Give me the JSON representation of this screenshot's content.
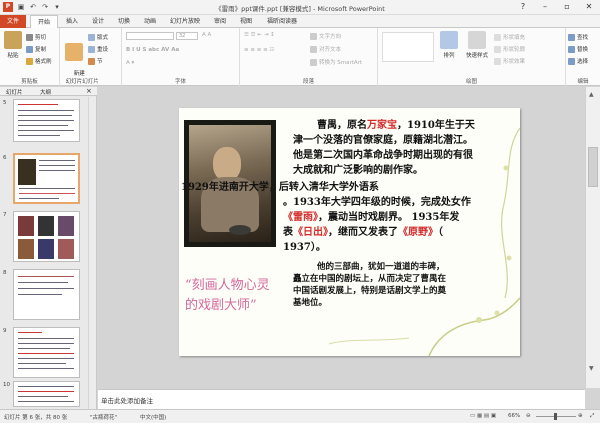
{
  "window": {
    "title": "《雷雨》ppt课件.ppt [兼容模式] - Microsoft PowerPoint",
    "controls": [
      "?",
      "–",
      "▫",
      "✕"
    ]
  },
  "quick_access": [
    "save-icon",
    "undo-icon",
    "redo-icon",
    "customize-icon"
  ],
  "ribbon_tabs": [
    "文件",
    "开始",
    "插入",
    "设计",
    "切换",
    "动画",
    "幻灯片放映",
    "审阅",
    "视图",
    "福昕阅读器"
  ],
  "ribbon": {
    "clipboard": {
      "paste": "粘贴",
      "cut": "剪切",
      "copy": "复制",
      "format": "格式刷",
      "label": "剪贴板"
    },
    "slides": {
      "new": "新建\n幻灯片",
      "layout": "版式",
      "reset": "重设",
      "section": "节",
      "label": "幻灯片"
    },
    "font": {
      "size": "32",
      "label": "字体"
    },
    "paragraph": {
      "text_dir": "文字方向",
      "align_text": "对齐文本",
      "smartart": "转换为 SmartArt",
      "label": "段落"
    },
    "drawing": {
      "arrange": "排列",
      "quick_styles": "快速样式",
      "fill": "形状填充",
      "outline": "形状轮廓",
      "effects": "形状效果",
      "label": "绘图"
    },
    "editing": {
      "find": "查找",
      "replace": "替换",
      "select": "选择",
      "label": "编辑"
    }
  },
  "left_pane": {
    "tab_slides": "幻灯片",
    "tab_outline": "大纲",
    "close": "×"
  },
  "thumbnails": [
    {
      "num": "5"
    },
    {
      "num": "6"
    },
    {
      "num": "7"
    },
    {
      "num": "8"
    },
    {
      "num": "9"
    },
    {
      "num": "10"
    }
  ],
  "slide": {
    "p1": [
      "曹禺，原名",
      "万家宝",
      "，1910年生于天",
      "津一个没落的官僚家庭，原籍湖北潜江。",
      "他是第二次国内革命战争时期出现的有很",
      "大成就和广泛影响的剧作家。"
    ],
    "p2": [
      "1929年进南开大学，后转入清华大学外语系",
      "。1933年大学四年级的时候，完成处女作",
      "《雷雨》",
      "，震动当时戏剧界。 1935年发",
      "表",
      "《日出》",
      "，继而又发表了",
      "《原野》",
      "（",
      "1937）。"
    ],
    "p3": [
      "他的三部曲，犹如一道道的丰碑，",
      "矗立在中国的剧坛上，从而决定了曹禺在",
      "中国话剧发展上，特别是话剧文学上的奠",
      "基地位。"
    ],
    "caption": [
      "“刻画人物心灵",
      "的戏剧大师”"
    ]
  },
  "notes_placeholder": "单击此处添加备注",
  "status_bar": {
    "slide_info": "幻灯片 第 6 张，共 80 张",
    "theme": "\"古瓶荷花\"",
    "language": "中文(中国)",
    "zoom": "66%"
  }
}
